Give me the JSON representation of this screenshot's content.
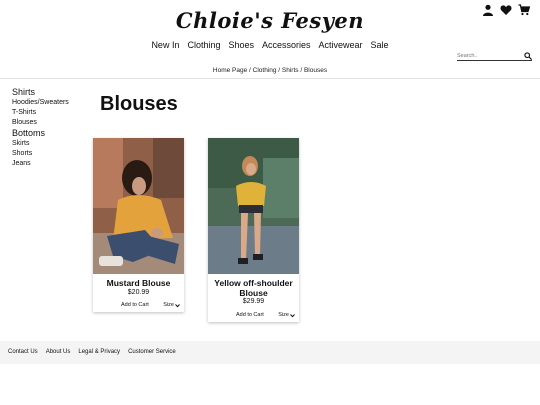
{
  "brand": {
    "logo": "Chloie's Fesyen"
  },
  "header_icons": [
    "user-icon",
    "heart-icon",
    "cart-icon"
  ],
  "nav": [
    "New In",
    "Clothing",
    "Shoes",
    "Accessories",
    "Activewear",
    "Sale"
  ],
  "search": {
    "placeholder": "Search.."
  },
  "breadcrumb": "Home Page / Clothing / Shirts / Blouses",
  "sidebar": {
    "groups": [
      {
        "title": "Shirts",
        "items": [
          "Hoodies/Sweaters",
          "T-Shirts",
          "Blouses"
        ]
      },
      {
        "title": "Bottoms",
        "items": [
          "Skirts",
          "Shorts",
          "Jeans"
        ]
      }
    ]
  },
  "page_title": "Blouses",
  "products": [
    {
      "name_line1": "Mustard Blouse",
      "name_line2": "",
      "price": "$20.99",
      "add_to_cart": "Add to Cart",
      "size_label": "Size"
    },
    {
      "name_line1": "Yellow off-shoulder",
      "name_line2": "Blouse",
      "price": "$29.99",
      "add_to_cart": "Add to Cart",
      "size_label": "Size"
    }
  ],
  "footer": {
    "links": [
      "Contact Us",
      "About Us",
      "Legal & Privacy",
      "Customer Service"
    ]
  }
}
